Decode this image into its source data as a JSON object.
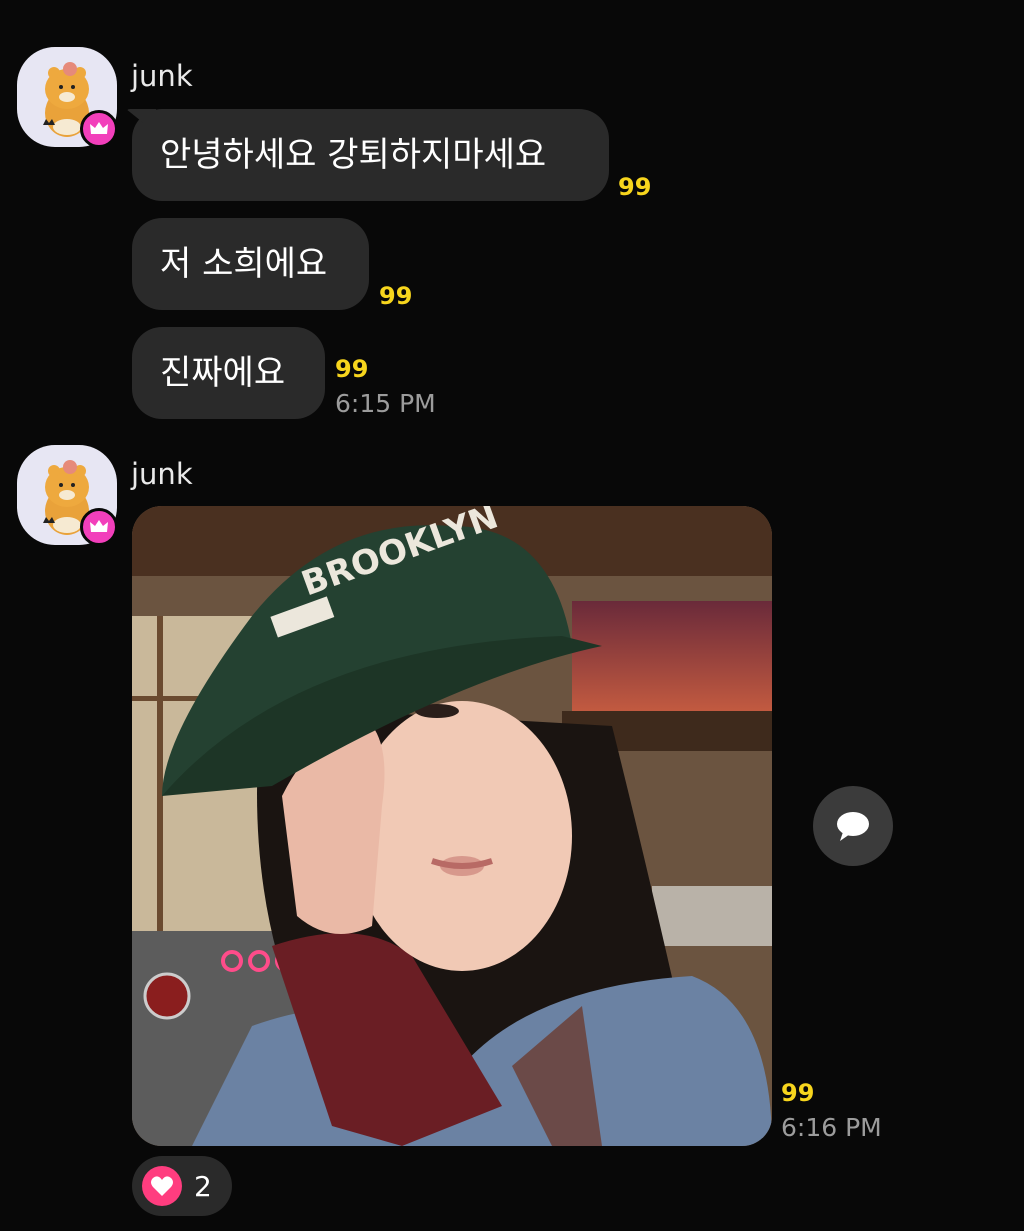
{
  "messages_group_1": {
    "sender": "junk",
    "bubbles": [
      {
        "text": "안녕하세요 강퇴하지마세요",
        "unread": "99"
      },
      {
        "text": "저 소희에요",
        "unread": "99"
      },
      {
        "text": "진짜에요",
        "unread": "99",
        "time": "6:15 PM"
      }
    ]
  },
  "messages_group_2": {
    "sender": "junk",
    "photo": {
      "unread": "99",
      "time": "6:16 PM"
    },
    "reaction": {
      "icon": "heart-icon",
      "count": "2"
    }
  },
  "icons": {
    "avatar": "ryan-character-icon",
    "badge": "crown-icon",
    "share": "speech-bubble-icon"
  },
  "colors": {
    "background": "#080808",
    "bubble": "#2a2a2a",
    "unread": "#f7d51d",
    "badge": "#f23fbb",
    "heart": "#ff3d7f"
  }
}
